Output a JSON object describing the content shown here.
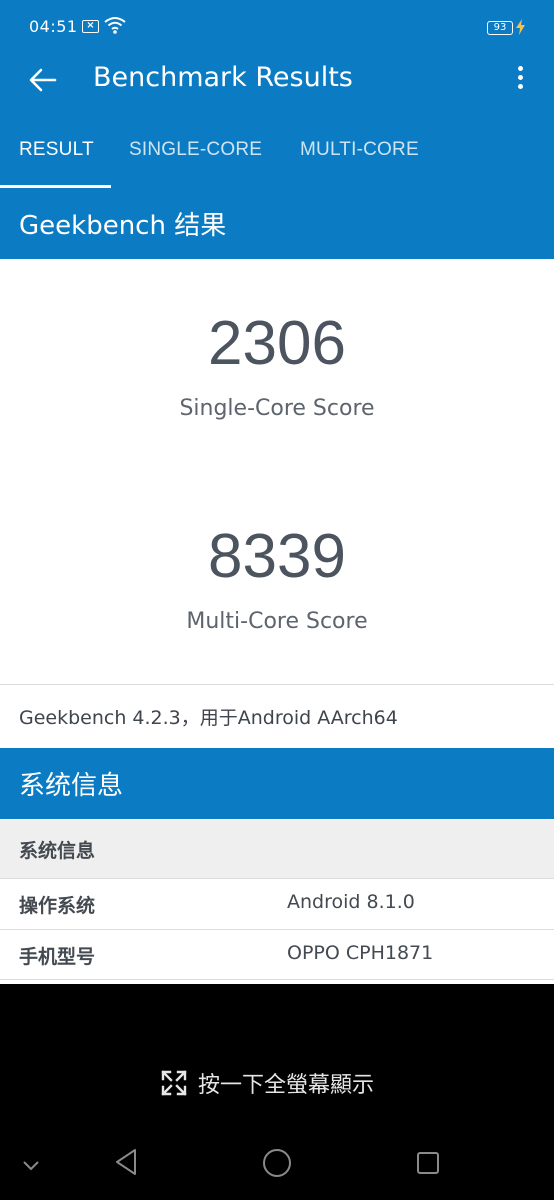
{
  "status_bar": {
    "time": "04:51",
    "notification_icon": "x-box-icon",
    "wifi_icon": "wifi-icon",
    "battery_level": "93",
    "charging_icon": "bolt-icon"
  },
  "app_bar": {
    "back_icon": "arrow-left-icon",
    "title": "Benchmark Results",
    "menu_icon": "more-vertical-icon"
  },
  "tabs": [
    {
      "label": "RESULT",
      "active": true
    },
    {
      "label": "SINGLE-CORE",
      "active": false
    },
    {
      "label": "MULTI-CORE",
      "active": false
    }
  ],
  "results_section": {
    "header": "Geekbench 结果",
    "single_core": {
      "score": "2306",
      "label": "Single-Core Score"
    },
    "multi_core": {
      "score": "8339",
      "label": "Multi-Core Score"
    },
    "version_text": "Geekbench 4.2.3，用于Android AArch64"
  },
  "system_section": {
    "header": "系统信息",
    "table_header": "系统信息",
    "rows": [
      {
        "label": "操作系统",
        "value": "Android 8.1.0"
      },
      {
        "label": "手机型号",
        "value": "OPPO CPH1871"
      }
    ]
  },
  "fullscreen_overlay": {
    "icon": "expand-icon",
    "label": "按一下全螢幕顯示"
  },
  "nav_bar": {
    "items": [
      "chevron-down-icon",
      "back-triangle-icon",
      "home-circle-icon",
      "recents-square-icon"
    ]
  },
  "colors": {
    "accent": "#0b7cc3",
    "score_text": "#4c5460",
    "overlay": "#000000"
  }
}
